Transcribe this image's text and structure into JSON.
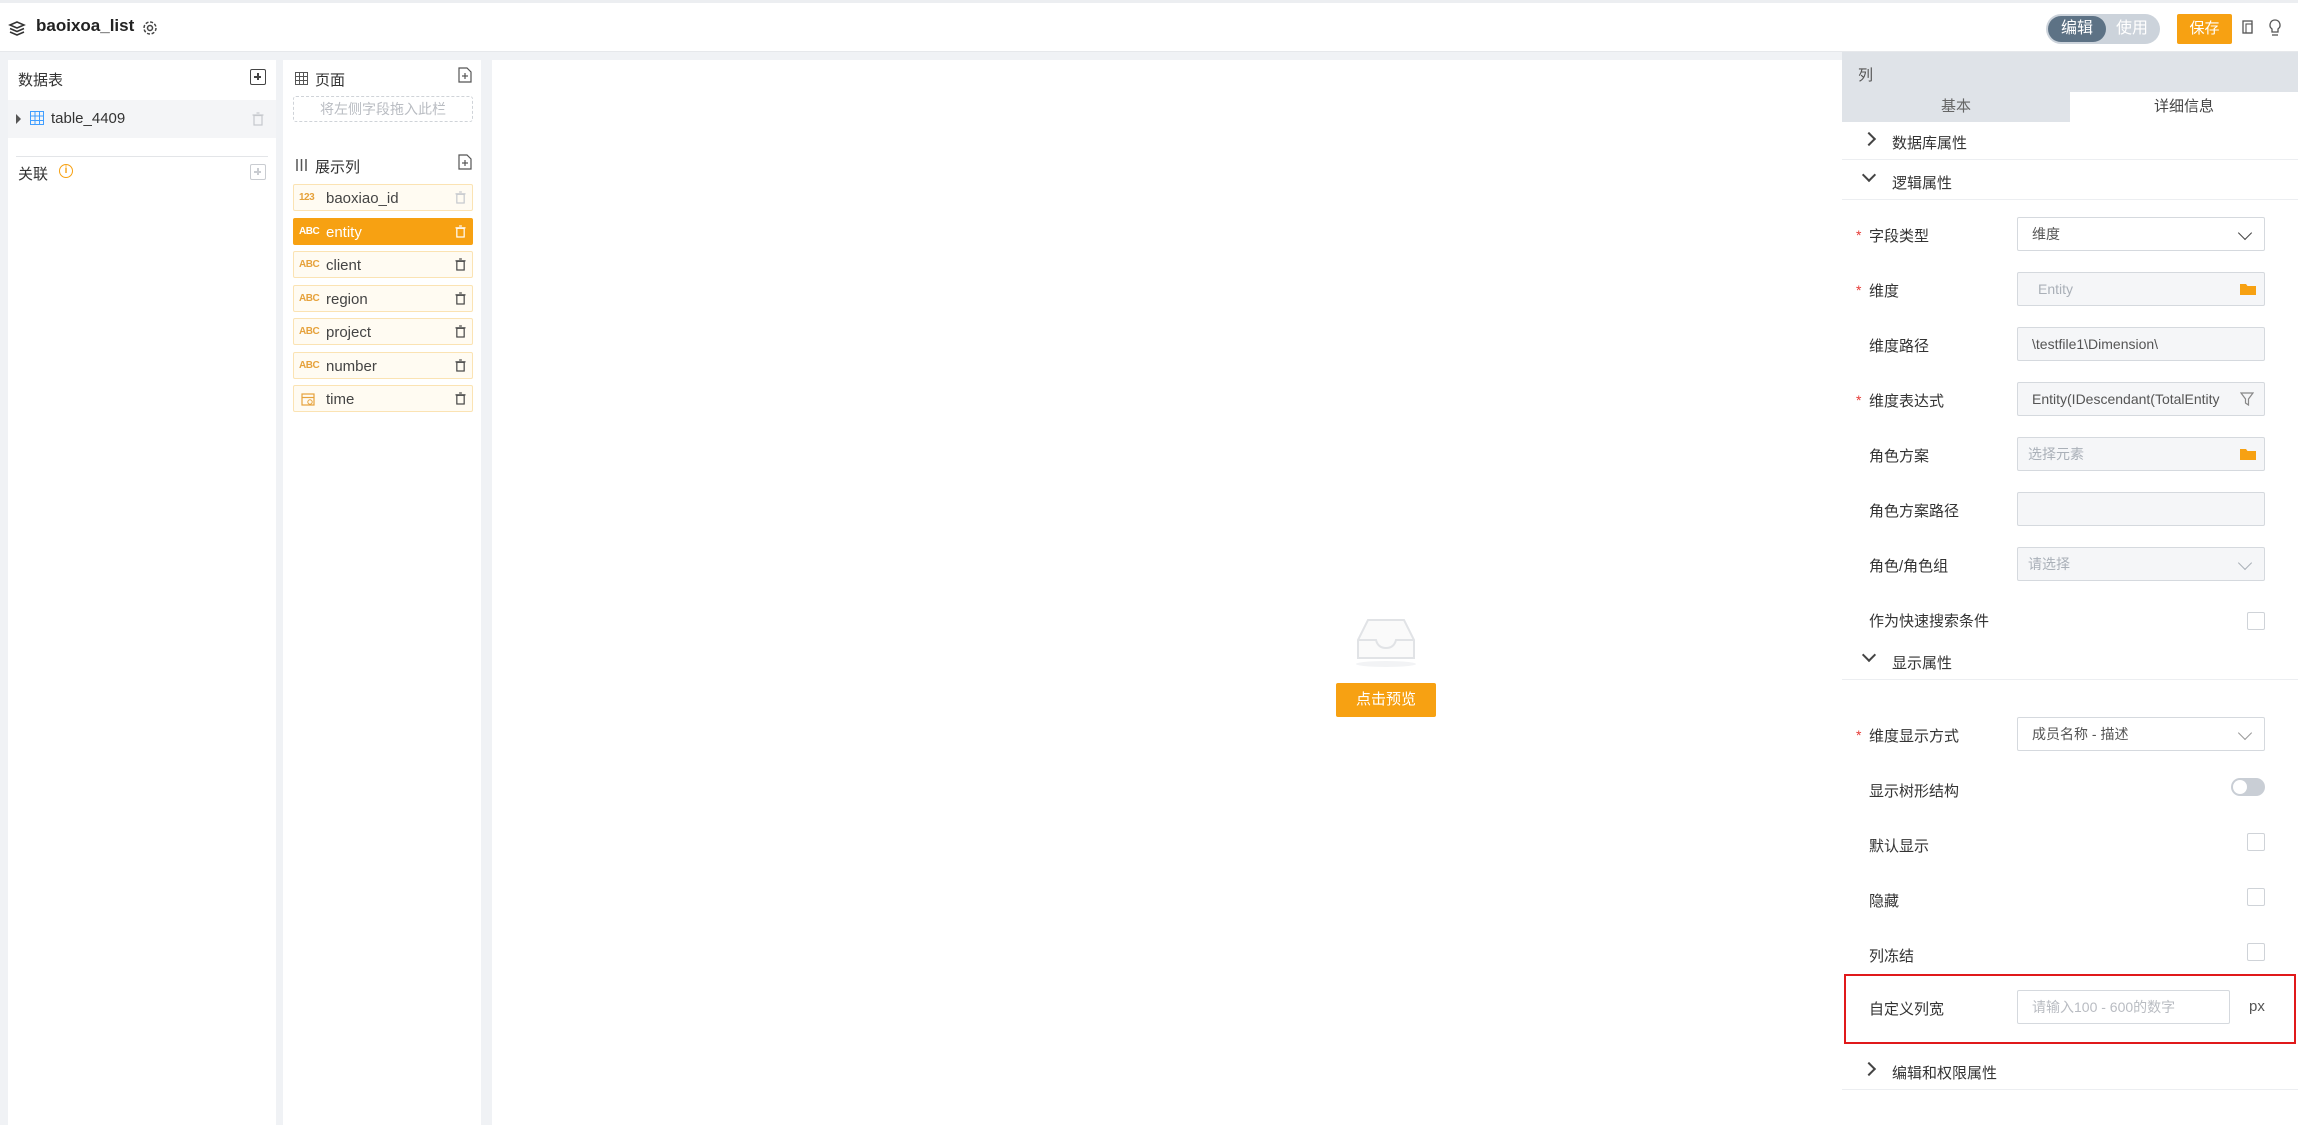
{
  "topbar": {
    "title": "baoixoa_list",
    "mode_edit": "编辑",
    "mode_use": "使用",
    "save_label": "保存",
    "icons": [
      "layers-icon",
      "gear-icon",
      "copy-icon",
      "bulb-icon"
    ]
  },
  "tables_panel": {
    "header": "数据表",
    "table_name": "table_4409",
    "relations_label": "关联"
  },
  "fields_panel": {
    "page_label": "页面",
    "drop_hint": "将左侧字段拖入此栏",
    "columns_label": "展示列",
    "fields": [
      {
        "type": "123",
        "name": "baoxiao_id",
        "active": false
      },
      {
        "type": "ABC",
        "name": "entity",
        "active": true
      },
      {
        "type": "ABC",
        "name": "client",
        "active": false
      },
      {
        "type": "ABC",
        "name": "region",
        "active": false
      },
      {
        "type": "ABC",
        "name": "project",
        "active": false
      },
      {
        "type": "ABC",
        "name": "number",
        "active": false
      },
      {
        "type": "date",
        "name": "time",
        "active": false
      }
    ]
  },
  "canvas": {
    "preview_label": "点击预览"
  },
  "props": {
    "title": "列",
    "tab_basic": "基本",
    "tab_detail": "详细信息",
    "sections": {
      "db": "数据库属性",
      "logic": "逻辑属性",
      "display": "显示属性",
      "edit": "编辑和权限属性"
    },
    "field_type_label": "字段类型",
    "field_type_value": "维度",
    "dimension_label": "维度",
    "dimension_placeholder": "Entity",
    "dimension_path_label": "维度路径",
    "dimension_path_value": "\\testfile1\\Dimension\\",
    "dimension_expr_label": "维度表达式",
    "dimension_expr_value": "Entity(IDescendant(TotalEntity",
    "role_scheme_label": "角色方案",
    "role_scheme_placeholder": "选择元素",
    "role_scheme_path_label": "角色方案路径",
    "role_group_label": "角色/角色组",
    "role_group_placeholder": "请选择",
    "quick_search_label": "作为快速搜索条件",
    "dim_display_label": "维度显示方式",
    "dim_display_value": "成员名称 - 描述",
    "tree_label": "显示树形结构",
    "default_show_label": "默认显示",
    "hide_label": "隐藏",
    "freeze_label": "列冻结",
    "custom_width_label": "自定义列宽",
    "custom_width_placeholder": "请输入100 - 600的数字",
    "unit": "px"
  }
}
